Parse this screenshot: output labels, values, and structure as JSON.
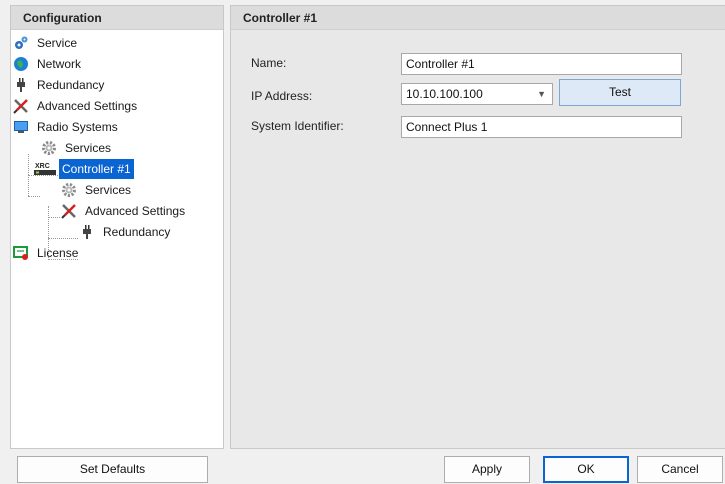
{
  "left_panel": {
    "title": "Configuration",
    "tree": [
      {
        "label": "Service",
        "icon": "service-gears-icon"
      },
      {
        "label": "Network",
        "icon": "globe-icon"
      },
      {
        "label": "Redundancy",
        "icon": "plug-icon"
      },
      {
        "label": "Advanced Settings",
        "icon": "wrench-screwdriver-icon"
      },
      {
        "label": "Radio Systems",
        "icon": "monitor-icon"
      },
      {
        "label": "Services",
        "icon": "gear-icon"
      },
      {
        "label": "Controller #1",
        "icon": "xrc-controller-icon"
      },
      {
        "label": "Services",
        "icon": "gear-icon"
      },
      {
        "label": "Advanced Settings",
        "icon": "wrench-screwdriver-icon"
      },
      {
        "label": "Redundancy",
        "icon": "plug-icon"
      },
      {
        "label": "License",
        "icon": "license-icon"
      }
    ],
    "set_defaults_label": "Set Defaults"
  },
  "right_panel": {
    "title": "Controller #1",
    "name_label": "Name:",
    "name_value": "Controller #1",
    "ip_label": "IP Address:",
    "ip_value": "10.10.100.100",
    "test_label": "Test",
    "sysid_label": "System Identifier:",
    "sysid_value": "Connect Plus 1"
  },
  "footer": {
    "apply_label": "Apply",
    "ok_label": "OK",
    "cancel_label": "Cancel"
  },
  "colors": {
    "selection": "#0a64d2",
    "header_bg": "#dcdcdc",
    "test_button_bg": "#dde9f6"
  }
}
